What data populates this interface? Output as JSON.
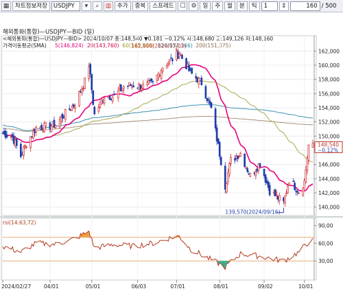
{
  "toolbar": {
    "grid_icon": "grid-icon",
    "save_label": "차트정보저장",
    "symbol_value": "USDJPY",
    "add_label": "추가",
    "overlay_label": "중복",
    "spread_label": "스프레드",
    "period_buttons": [
      "일",
      "주",
      "월",
      "분",
      "틱"
    ],
    "count_value": "1",
    "range_value": "160",
    "range_total": "/ 500"
  },
  "chart": {
    "title": "해외통화(통합)—USDJPY—BID (일)",
    "info_line": "<해외통화(통합)—USDJPY—BID> 2024/10/07 종:148,540 ▼0.181 −0.12% 시:148,680 고:149,126 저:148,160",
    "ma_label": "가격이동평균(SMA)",
    "ma_values": [
      {
        "label": "5(146,824)",
        "color": "#e6007e"
      },
      {
        "label": "20(143,760)",
        "color": "#cc0044"
      },
      {
        "label": "60(145,916)",
        "color": "#9a9a2a"
      },
      {
        "label": "120(152,166)",
        "color": "#2a8aa8"
      },
      {
        "label": "200(151,075)",
        "color": "#8b6b4a"
      }
    ],
    "high_annotation": "162,000(2024/07/03)",
    "low_annotation": "139,570(2024/09/16)",
    "last_price": "148,540",
    "last_change": "−0.12%",
    "price_ticks": [
      "162,000",
      "160,000",
      "158,000",
      "156,000",
      "154,000",
      "152,000",
      "150,000",
      "148,000",
      "146,000",
      "144,000",
      "142,000",
      "140,000"
    ],
    "rsi_label": "rsi(14:63,72)",
    "rsi_ticks": [
      "90,00",
      "60,00",
      "30,00"
    ],
    "date_ticks": [
      "2024/02/27",
      "04/01",
      "05/01",
      "06/03",
      "07/01",
      "08/01",
      "09/02",
      "10/01"
    ]
  },
  "colors": {
    "up": "#d1242a",
    "down": "#1f3ea8",
    "ma5": "#e6007e",
    "ma60": "#a8a850",
    "ma120": "#3a8fb0",
    "ma200": "#a8907a",
    "rsi_line": "#b03a1e",
    "overbought_fill": "#f0a040",
    "oversold_fill": "#30b090",
    "rsi_guide": "#e8a060"
  },
  "chart_data": {
    "type": "candlestick",
    "price_ylim": [
      139000,
      163000
    ],
    "rsi_ylim": [
      0,
      100
    ],
    "rsi_levels": [
      70,
      30
    ],
    "close_path_points": [
      [
        "2024/02/27",
        150.4
      ],
      [
        "2024/03/05",
        149.9
      ],
      [
        "2024/03/11",
        147.2
      ],
      [
        "2024/03/15",
        149.0
      ],
      [
        "2024/03/22",
        151.2
      ],
      [
        "2024/03/28",
        151.3
      ],
      [
        "2024/04/05",
        151.6
      ],
      [
        "2024/04/12",
        153.2
      ],
      [
        "2024/04/19",
        154.6
      ],
      [
        "2024/04/26",
        157.7
      ],
      [
        "2024/04/29",
        160.1
      ],
      [
        "2024/05/03",
        153.0
      ],
      [
        "2024/05/10",
        155.7
      ],
      [
        "2024/05/17",
        155.6
      ],
      [
        "2024/05/24",
        157.0
      ],
      [
        "2024/05/31",
        157.2
      ],
      [
        "2024/06/07",
        157.0
      ],
      [
        "2024/06/14",
        157.4
      ],
      [
        "2024/06/21",
        159.8
      ],
      [
        "2024/06/28",
        160.9
      ],
      [
        "2024/07/03",
        161.7
      ],
      [
        "2024/07/11",
        158.9
      ],
      [
        "2024/07/19",
        157.5
      ],
      [
        "2024/07/26",
        153.8
      ],
      [
        "2024/08/02",
        146.5
      ],
      [
        "2024/08/05",
        143.0
      ],
      [
        "2024/08/09",
        146.6
      ],
      [
        "2024/08/16",
        147.6
      ],
      [
        "2024/08/23",
        144.4
      ],
      [
        "2024/08/30",
        146.2
      ],
      [
        "2024/09/06",
        142.3
      ],
      [
        "2024/09/16",
        140.6
      ],
      [
        "2024/09/20",
        143.9
      ],
      [
        "2024/09/27",
        142.2
      ],
      [
        "2024/10/01",
        143.6
      ],
      [
        "2024/10/04",
        148.7
      ],
      [
        "2024/10/07",
        148.5
      ]
    ],
    "rsi_points": [
      [
        "2024/02/27",
        55
      ],
      [
        "2024/03/11",
        45
      ],
      [
        "2024/03/22",
        60
      ],
      [
        "2024/04/05",
        58
      ],
      [
        "2024/04/19",
        68
      ],
      [
        "2024/04/29",
        80
      ],
      [
        "2024/05/03",
        52
      ],
      [
        "2024/05/17",
        58
      ],
      [
        "2024/05/31",
        55
      ],
      [
        "2024/06/14",
        60
      ],
      [
        "2024/06/28",
        70
      ],
      [
        "2024/07/03",
        72
      ],
      [
        "2024/07/11",
        50
      ],
      [
        "2024/07/26",
        32
      ],
      [
        "2024/08/05",
        20
      ],
      [
        "2024/08/16",
        42
      ],
      [
        "2024/08/30",
        38
      ],
      [
        "2024/09/16",
        30
      ],
      [
        "2024/09/27",
        45
      ],
      [
        "2024/10/04",
        62
      ],
      [
        "2024/10/07",
        64
      ]
    ]
  }
}
